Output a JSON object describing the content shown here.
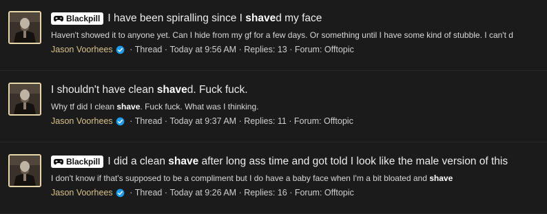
{
  "colors": {
    "background": "#1b1b1b",
    "author": "#d8c28c",
    "verified": "#1d9bf0",
    "prefix_bg": "#ffffff",
    "avatar_border": "#e8d7a8"
  },
  "threads": [
    {
      "prefix": "Blackpill",
      "prefix_icon": "gamepad-icon",
      "title": [
        "I have been spiralling since I ",
        "shave",
        "d my face"
      ],
      "snippet": [
        "Haven't showed it to anyone yet. Can I hide from my gf for a few days. Or something until I have some kind of stubble. I can't d"
      ],
      "author": "Jason Voorhees",
      "meta": {
        "sep1": " · ",
        "type": "Thread",
        "sep2": " · ",
        "date": "Today at 9:56 AM",
        "sep3": " · ",
        "replies": "Replies: 13",
        "sep4": " · ",
        "forum": "Forum: Offtopic"
      }
    },
    {
      "prefix": "",
      "title": [
        "I shouldn't have clean ",
        "shave",
        "d. Fuck fuck."
      ],
      "snippet": [
        "Why tf did I clean ",
        "shave",
        ". Fuck fuck. What was I thinking."
      ],
      "author": "Jason Voorhees",
      "meta": {
        "sep1": " · ",
        "type": "Thread",
        "sep2": " · ",
        "date": "Today at 9:37 AM",
        "sep3": " · ",
        "replies": "Replies: 11",
        "sep4": " · ",
        "forum": "Forum: Offtopic"
      }
    },
    {
      "prefix": "Blackpill",
      "prefix_icon": "gamepad-icon",
      "title": [
        "I did a clean ",
        "shave",
        " after long ass time and got told I look like the male version of this"
      ],
      "snippet": [
        "I don't know if that's supposed to be a compliment but I do have a baby face when I'm a bit bloated and ",
        "shave"
      ],
      "author": "Jason Voorhees",
      "meta": {
        "sep1": " · ",
        "type": "Thread",
        "sep2": " · ",
        "date": "Today at 9:26 AM",
        "sep3": " · ",
        "replies": "Replies: 16",
        "sep4": " · ",
        "forum": "Forum: Offtopic"
      }
    }
  ]
}
